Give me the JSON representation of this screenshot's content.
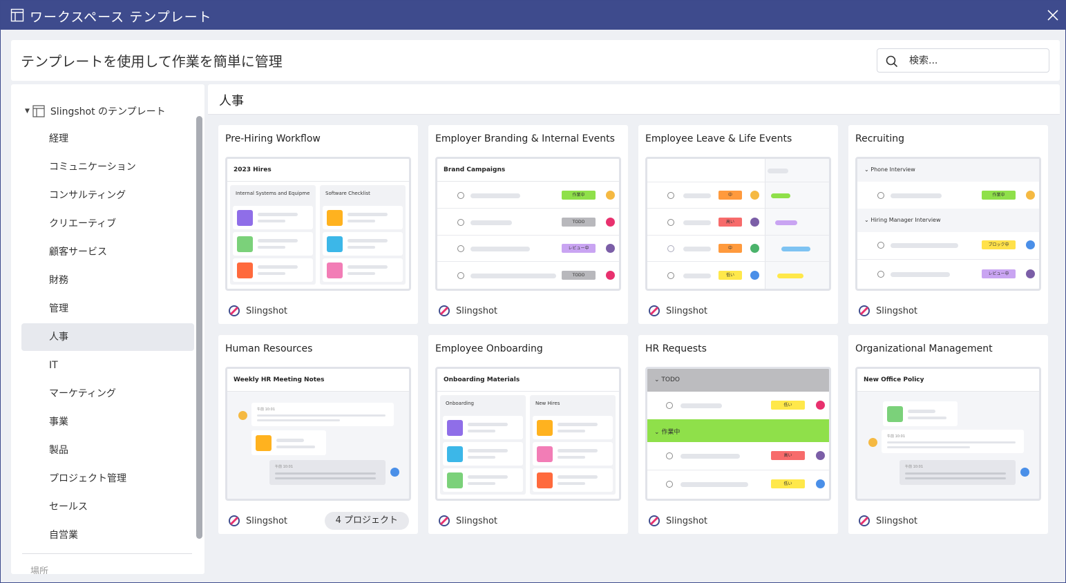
{
  "window": {
    "title": "ワークスペース テンプレート"
  },
  "header": {
    "title": "テンプレートを使用して作業を簡単に管理",
    "search_placeholder": "検索..."
  },
  "sidebar": {
    "root_label": "Slingshot のテンプレート",
    "items": [
      "経理",
      "コミュニケーション",
      "コンサルティング",
      "クリエーティブ",
      "顧客サービス",
      "財務",
      "管理",
      "人事",
      "IT",
      "マーケティング",
      "事業",
      "製品",
      "プロジェクト管理",
      "セールス",
      "自営業"
    ],
    "active_item": "人事",
    "footer_label": "場所"
  },
  "main": {
    "category_title": "人事",
    "brand_label": "Slingshot",
    "cards": [
      {
        "title": "Pre-Hiring Workflow",
        "preview_title": "2023 Hires",
        "columns": [
          "Internal Systems and Equipme",
          "Software Checklist"
        ]
      },
      {
        "title": "Employer Branding & Internal Events",
        "preview_title": "Brand Campaigns",
        "tags": [
          "作業中",
          "TODO",
          "レビュー中",
          "TODO"
        ]
      },
      {
        "title": "Employee Leave & Life Events",
        "tags": [
          "中",
          "高い",
          "中",
          "低い"
        ]
      },
      {
        "title": "Recruiting",
        "groups": [
          "Phone Interview",
          "Hiring Manager Interview"
        ],
        "tags": [
          "作業中",
          "ブロック中",
          "レビュー中"
        ]
      },
      {
        "title": "Human Resources",
        "preview_title": "Weekly HR Meeting Notes",
        "times": [
          "午前 10:01",
          "午前 10:01"
        ],
        "pill": "4 プロジェクト"
      },
      {
        "title": "Employee Onboarding",
        "preview_title": "Onboarding Materials",
        "columns": [
          "Onboarding",
          "New Hires"
        ]
      },
      {
        "title": "HR Requests",
        "groups": [
          "TODO",
          "作業中"
        ],
        "tags": [
          "低い",
          "高い",
          "低い"
        ]
      },
      {
        "title": "Organizational Management",
        "preview_title": "New Office Policy",
        "times": [
          "午前 10:01",
          "午前 10:01"
        ]
      }
    ]
  },
  "colors": {
    "titlebar": "#3e4b8d",
    "in_progress": "#8fe04a",
    "todo": "#b8b8bc",
    "review": "#c9a4f2",
    "blocked": "#ffe14a",
    "high": "#f76b6b",
    "medium": "#ff9a3d",
    "low": "#ffe84a"
  }
}
